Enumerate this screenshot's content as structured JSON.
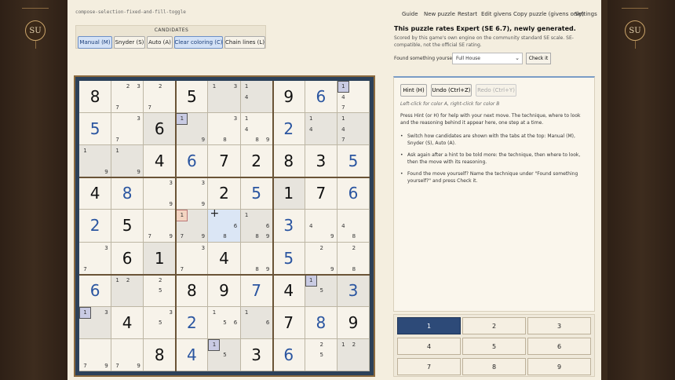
{
  "brand": {
    "emblem": "SU"
  },
  "crumb": "compose-selection-fixed-and-fill-toggle",
  "nav": [
    "Guide",
    "New puzzle",
    "Restart",
    "Edit givens",
    "Copy puzzle (givens only)",
    "Settings"
  ],
  "candidates": {
    "title": "CANDIDATES",
    "buttons": [
      {
        "label": "Manual (M)",
        "active": true
      },
      {
        "label": "Snyder (S)",
        "active": false
      },
      {
        "label": "Auto (A)",
        "active": false
      },
      {
        "label": "Clear coloring (C)",
        "active": true
      },
      {
        "label": "Chain lines (L)",
        "active": false
      }
    ]
  },
  "info": {
    "title": "This puzzle rates Expert (SE 6.7), newly generated.",
    "subtitle": "Scored by this game's own engine on the community standard SE scale. SE-compatible, not the official SE rating.",
    "found_label": "Found something yourself?",
    "found_value": "Full House",
    "check_label": "Check it"
  },
  "help": {
    "hint_button": "Hint (H)",
    "undo_button": "Undo (Ctrl+Z)",
    "redo_button": "Redo (Ctrl+Y)",
    "click_hint": "Left-click for color A, right-click for color B",
    "intro": "Press Hint (or H) for help with your next move. The technique, where to look and the reasoning behind it appear here, one step at a time.",
    "bullets": [
      "Switch how candidates are shown with the tabs at the top: Manual (M), Snyder (S), Auto (A).",
      "Ask again after a hint to be told more: the technique, then where to look, then the move with its reasoning.",
      "Found the move yourself? Name the technique under \"Found something yourself?\" and press Check it."
    ]
  },
  "numpad": {
    "keys": [
      "1",
      "2",
      "3",
      "4",
      "5",
      "6",
      "7",
      "8",
      "9"
    ],
    "active": "1"
  },
  "board": {
    "givens": [
      [
        8,
        0,
        0,
        5,
        0,
        0,
        9,
        6,
        0
      ],
      [
        5,
        0,
        6,
        0,
        0,
        0,
        2,
        0,
        0
      ],
      [
        0,
        0,
        4,
        6,
        7,
        2,
        8,
        3,
        5
      ],
      [
        4,
        8,
        0,
        0,
        2,
        5,
        1,
        7,
        6
      ],
      [
        2,
        5,
        0,
        0,
        0,
        0,
        3,
        0,
        0
      ],
      [
        0,
        6,
        1,
        0,
        4,
        0,
        5,
        0,
        0
      ],
      [
        6,
        0,
        0,
        8,
        9,
        7,
        4,
        0,
        3
      ],
      [
        0,
        4,
        0,
        2,
        0,
        0,
        7,
        8,
        9
      ],
      [
        0,
        0,
        8,
        4,
        0,
        3,
        6,
        0,
        0
      ]
    ],
    "solved_blue": [
      [
        1,
        0
      ],
      [
        7,
        0
      ],
      [
        0,
        7
      ],
      [
        3,
        3
      ],
      [
        2,
        3
      ],
      [
        3,
        1
      ],
      [
        3,
        5
      ],
      [
        3,
        8
      ],
      [
        4,
        0
      ],
      [
        4,
        6
      ],
      [
        5,
        6
      ],
      [
        6,
        0
      ],
      [
        6,
        5
      ],
      [
        6,
        8
      ],
      [
        7,
        3
      ],
      [
        7,
        7
      ],
      [
        8,
        3
      ],
      [
        8,
        6
      ],
      [
        2,
        8
      ],
      [
        1,
        6
      ]
    ],
    "candidates": {
      "0,1": [
        2,
        3,
        7
      ],
      "0,2": [
        2,
        7
      ],
      "0,4": [
        1,
        3
      ],
      "0,5": [
        1,
        4
      ],
      "0,8": [
        1,
        4,
        7
      ],
      "1,1": [
        3,
        7
      ],
      "1,3": [
        1,
        9
      ],
      "1,4": [
        3,
        8
      ],
      "1,5": [
        1,
        4,
        8,
        9
      ],
      "1,7": [
        1,
        4
      ],
      "1,8": [
        1,
        4,
        7
      ],
      "2,0": [
        1,
        9
      ],
      "2,1": [
        1,
        9
      ],
      "3,2": [
        3,
        9
      ],
      "3,3": [
        3,
        9
      ],
      "4,2": [
        7,
        9
      ],
      "4,3": [
        1,
        7,
        9
      ],
      "4,4": [
        6,
        8
      ],
      "4,5": [
        1,
        6,
        8,
        9
      ],
      "4,7": [
        4,
        9
      ],
      "4,8": [
        4,
        8
      ],
      "5,0": [
        3,
        7
      ],
      "5,3": [
        3,
        7
      ],
      "5,5": [
        8,
        9
      ],
      "5,7": [
        2,
        9
      ],
      "5,8": [
        2,
        8
      ],
      "6,1": [
        1,
        2
      ],
      "6,2": [
        2,
        5
      ],
      "6,7": [
        1,
        5
      ],
      "7,0": [
        1,
        3
      ],
      "7,2": [
        3,
        5
      ],
      "7,4": [
        1,
        5,
        6
      ],
      "7,5": [
        1,
        6
      ],
      "8,0": [
        7,
        9
      ],
      "8,1": [
        7,
        9
      ],
      "8,4": [
        1,
        5
      ],
      "8,7": [
        2,
        5
      ],
      "8,8": [
        1,
        2
      ]
    },
    "highlight_cands": [
      [
        "0,8",
        1
      ],
      [
        "1,3",
        1
      ],
      [
        "6,7",
        1
      ],
      [
        "7,0",
        1
      ],
      [
        "8,4",
        1
      ]
    ],
    "orange_cands": [
      [
        "4,3",
        1
      ]
    ],
    "shaded": [
      "0,4",
      "0,5",
      "1,3",
      "1,7",
      "1,8",
      "2,0",
      "2,1",
      "3,6",
      "4,3",
      "4,5",
      "5,2",
      "6,1",
      "6,7",
      "6,8",
      "7,0",
      "7,5",
      "8,4",
      "8,8",
      "1,2"
    ],
    "selected": "4,4"
  }
}
